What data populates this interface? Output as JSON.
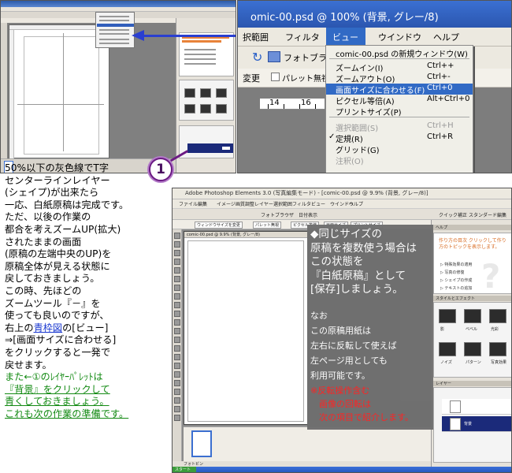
{
  "zoom_menu": {
    "window_title": "omic-00.psd @ 100% (背景, グレー/8)",
    "menu_items": [
      "択範囲",
      "フィルタ",
      "ビュー",
      "ウインドウ",
      "ヘルプ"
    ],
    "toolbar_browser": "フォトブラウザ",
    "toolbar_change": "変更",
    "toolbar_palette": "パレット無視",
    "ruler_labels": [
      "14",
      "16"
    ],
    "dropdown": [
      {
        "label": "comic-00.psd の新規ウィンドウ(W)",
        "shortcut": "",
        "state": "normal",
        "check": ""
      },
      {
        "label": "ズームイン(I)",
        "shortcut": "Ctrl++",
        "state": "normal",
        "check": ""
      },
      {
        "label": "ズームアウト(O)",
        "shortcut": "Ctrl+-",
        "state": "normal",
        "check": ""
      },
      {
        "label": "画面サイズに合わせる(F)",
        "shortcut": "Ctrl+0",
        "state": "selected",
        "check": ""
      },
      {
        "label": "ピクセル等倍(A)",
        "shortcut": "Alt+Ctrl+0",
        "state": "normal",
        "check": ""
      },
      {
        "label": "プリントサイズ(P)",
        "shortcut": "",
        "state": "normal",
        "check": ""
      },
      {
        "label": "選択範囲(S)",
        "shortcut": "Ctrl+H",
        "state": "disabled",
        "check": ""
      },
      {
        "label": "定規(R)",
        "shortcut": "Ctrl+R",
        "state": "normal",
        "check": "✓"
      },
      {
        "label": "グリッド(G)",
        "shortcut": "",
        "state": "normal",
        "check": ""
      },
      {
        "label": "注釈(O)",
        "shortcut": "",
        "state": "disabled",
        "check": ""
      }
    ]
  },
  "callout_number": "1",
  "instructions": {
    "lines": [
      "50%以下の灰色線でT字",
      "センターラインレイヤー",
      "(シェイプ)が出来たら",
      "一応、白紙原稿は完成です。",
      "ただ、以後の作業の",
      "都合を考えズームUP(拡大)",
      "されたままの画面",
      "(原稿の左端中央のUP)を",
      "原稿全体が見える状態に",
      "戻しておきましょう。",
      "この時、先ほどの",
      "ズームツール『－』を",
      "使っても良いのですが、"
    ],
    "line_blue_pre": "右上の",
    "line_blue_link": "青枠図",
    "line_blue_post": "の[ビュー]",
    "lines2": [
      "⇒[画面サイズに合わせる]",
      "をクリックすると一発で",
      "戻せます。"
    ],
    "green_lines": [
      "また←①のﾚｲﾔｰﾊﾟﾚｯﾄは",
      "『背景』をクリックして",
      "青くしておきましょう。",
      "これも次の作業の準備です。"
    ]
  },
  "main_window": {
    "title": "Adobe Photoshop Elements 3.0 (写真編集モード) - [comic-00.psd @ 9.9% (背景, グレー/8)]",
    "menu": [
      "ファイル",
      "編集",
      "イメージ",
      "画質調整",
      "レイヤー",
      "選択範囲",
      "フィルタ",
      "ビュー",
      "ウインドウ",
      "ヘルプ"
    ],
    "toolbar_browser": "フォトブラウザ",
    "toolbar_date": "日付表示",
    "quickfix": "クイック補正",
    "standard": "スタンダード編集",
    "options": [
      "ウィンドウサイズを変更",
      "パレット無視",
      "ピクセル等倍",
      "画面サイズ",
      "プリントサイズ"
    ],
    "doc_title": "comic-00.psd @ 9.9% (背景, グレー/8)",
    "help_title": "作り方の目次 クリックして作り方のトピックを表示します。",
    "help_items": [
      "▷ 特殊効果の適用",
      "▷ 写真の修復",
      "▷ シェイプの作成",
      "▷ テキストの追加"
    ],
    "styles_header": "スタイルとエフェクト",
    "style_labels": [
      "影",
      "ベベル",
      "光彩",
      "ノイズ",
      "パターン",
      "写真効果"
    ],
    "layers_header": "レイヤー",
    "layer_name": "背景",
    "taskbar_start": "スタート",
    "status": "フォトビン"
  },
  "note": {
    "big": [
      "◆同じサイズの",
      "原稿を複数使う場合は",
      "この状態を",
      "『白紙原稿』として",
      "[保存]しましょう。"
    ],
    "small": [
      "なお",
      "この原稿用紙は",
      "左右に反転して使えば",
      "左ページ用としても",
      "利用可能です。"
    ],
    "red": [
      "※反転操作含む",
      "　画像の回転は",
      "　次の項目で紹介します。"
    ]
  },
  "colors": {
    "menu_highlight": "#316ac5",
    "arrow": "#2a3fd0",
    "callout": "#6b1a83",
    "instruction_green": "#138a13",
    "note_red": "#ff2222"
  }
}
